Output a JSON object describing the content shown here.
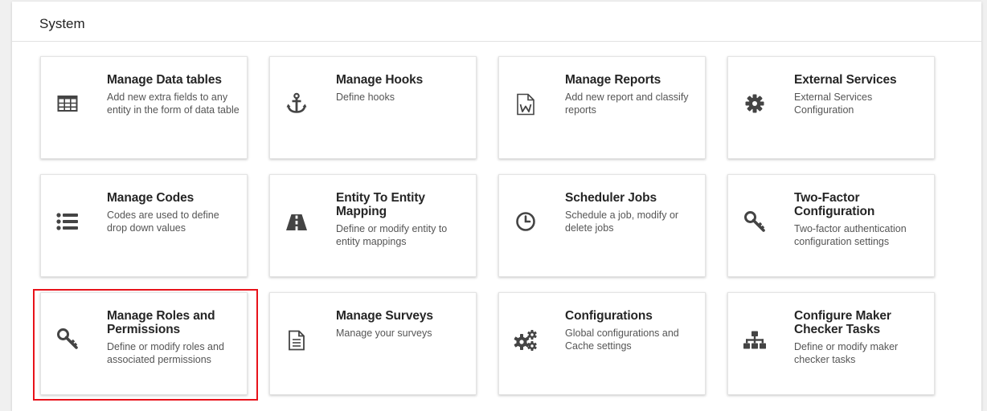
{
  "section": {
    "title": "System"
  },
  "cards": [
    {
      "title": "Manage Data tables",
      "desc": "Add new extra fields to any entity in the form of data table",
      "icon": "table-icon"
    },
    {
      "title": "Manage Hooks",
      "desc": "Define hooks",
      "icon": "anchor-icon"
    },
    {
      "title": "Manage Reports",
      "desc": "Add new report and classify reports",
      "icon": "word-file-icon"
    },
    {
      "title": "External Services",
      "desc": "External Services Configuration",
      "icon": "gear-icon"
    },
    {
      "title": "Manage Codes",
      "desc": "Codes are used to define drop down values",
      "icon": "list-icon"
    },
    {
      "title": "Entity To Entity Mapping",
      "desc": "Define or modify entity to entity mappings",
      "icon": "road-icon"
    },
    {
      "title": "Scheduler Jobs",
      "desc": "Schedule a job, modify or delete jobs",
      "icon": "clock-icon"
    },
    {
      "title": "Two-Factor Configuration",
      "desc": "Two-factor authentication configuration settings",
      "icon": "key-icon"
    },
    {
      "title": "Manage Roles and Permissions",
      "desc": "Define or modify roles and associated permissions",
      "icon": "key-icon"
    },
    {
      "title": "Manage Surveys",
      "desc": "Manage your surveys",
      "icon": "file-text-icon"
    },
    {
      "title": "Configurations",
      "desc": "Global configurations and Cache settings",
      "icon": "cogs-icon"
    },
    {
      "title": "Configure Maker Checker Tasks",
      "desc": "Define or modify maker checker tasks",
      "icon": "sitemap-icon"
    }
  ],
  "colors": {
    "highlight": "#e8121a",
    "icon": "#444444",
    "title": "#252525",
    "desc": "#555555"
  }
}
